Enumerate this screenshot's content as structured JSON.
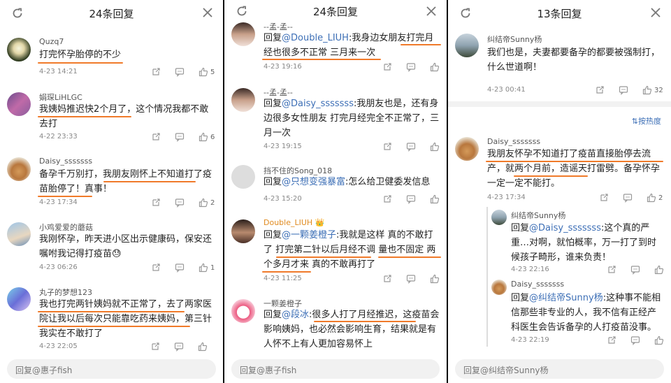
{
  "panels": [
    {
      "title": "24条回复",
      "reply_placeholder": "回复@惠子fish",
      "comments": [
        {
          "user": "Quzq7",
          "text": "打完怀孕胎停的不少",
          "time": "4-23 14:21",
          "likes": "5"
        },
        {
          "user": "娟琛LiHLGC",
          "text": "我姨妈推迟快2个月了，这个情况我都不敢去打",
          "time": "4-22 23:33",
          "likes": "6"
        },
        {
          "user": "Daisy_sssssss",
          "text": "备孕千万别打，我朋友刚怀上不知道打了疫苗胎停了！真事！",
          "time": "4-23 17:34",
          "likes": "2"
        },
        {
          "user": "小鸡爱爱的蘑菇",
          "text": "我刚怀孕，昨天进小区出示健康码，保安还嘱咐我记得打疫苗😓",
          "time": "4-23 06:26",
          "likes": "1"
        },
        {
          "user": "丸子的梦想123",
          "text": "我也打完两针姨妈就不正常了，去了两家医院让我以后每次只能靠吃药来姨妈，第三针我实在不敢打了",
          "time": "4-23 22:05",
          "likes": ""
        }
      ]
    },
    {
      "title": "24条回复",
      "reply_placeholder": "回复@惠子fish",
      "comments": [
        {
          "user": "--孟-孟--",
          "prefix": "回复",
          "mention": "@Double_LIUH",
          "text": ":我身边女朋友打完月经也很多不正常 三月来一次",
          "time": "4-23 19:16",
          "likes": ""
        },
        {
          "user": "--孟-孟--",
          "prefix": "回复",
          "mention": "@Daisy_sssssss",
          "text": ":我朋友也是，还有身边很多女性朋友 打完月经完全不正常了，三月一次",
          "time": "4-23 19:15",
          "likes": ""
        },
        {
          "user": "挡不住的Song_018",
          "prefix": "回复",
          "mention": "@只想变强暴富",
          "text": ":怎么给卫健委发信息",
          "time": "4-23 15:20",
          "likes": ""
        },
        {
          "user": "Double_LIUH",
          "badge": "👑",
          "prefix": "回复",
          "mention": "@一颗姜橙子",
          "text": ":我就是这样 真的不敢打了 打完第二针以后月经不调 量也不固定 两个多月才来 真的不敢再打了",
          "time": "4-23 11:25",
          "likes": ""
        },
        {
          "user": "一颗姜橙子",
          "prefix": "回复",
          "mention": "@段冰",
          "text": ":很多人打了月经推迟，这疫苗会影响姨妈，也必然会影响生育，结果就是有人怀不上有人更加容易怀上",
          "time": "",
          "likes": ""
        }
      ]
    },
    {
      "title": "13条回复",
      "reply_placeholder": "回复@纠结帝Sunny杨",
      "top_comment": {
        "user": "纠结帝Sunny杨",
        "text": "我们也是，夫妻都要备孕的都要被强制打，什么世道啊！",
        "time": "4-23 00:41",
        "likes": "32"
      },
      "sort_label": "按热度",
      "main_comment": {
        "user": "Daisy_sssssss",
        "text": "我朋友怀孕不知道打了疫苗直接胎停去流产，就两个月前，造谣天打雷劈。备孕怀孕一定一定不能打。",
        "time": "4-23 17:34",
        "likes": "2"
      },
      "replies": [
        {
          "user": "纠结帝Sunny杨",
          "prefix": "回复",
          "mention": "@Daisy_sssssss",
          "text": ":这个真的严重…对啊，就怕概率，万一打了到时候孩子畸形，谁来负责！",
          "time": "4-23 22:16",
          "likes": ""
        },
        {
          "user": "Daisy_sssssss",
          "prefix": "回复",
          "mention": "@纠结帝Sunny杨",
          "text": ":这种事不能相信那些非专业的人，我不信有正经产科医生会告诉备孕的人打疫苗没事。",
          "time": "4-23 22:19",
          "likes": ""
        }
      ]
    }
  ],
  "icons": [
    "refresh-icon",
    "close-icon",
    "share-icon",
    "comment-icon",
    "like-icon"
  ],
  "colors": {
    "accent_underline": "#f07a2a",
    "mention": "#3d6fb6"
  }
}
